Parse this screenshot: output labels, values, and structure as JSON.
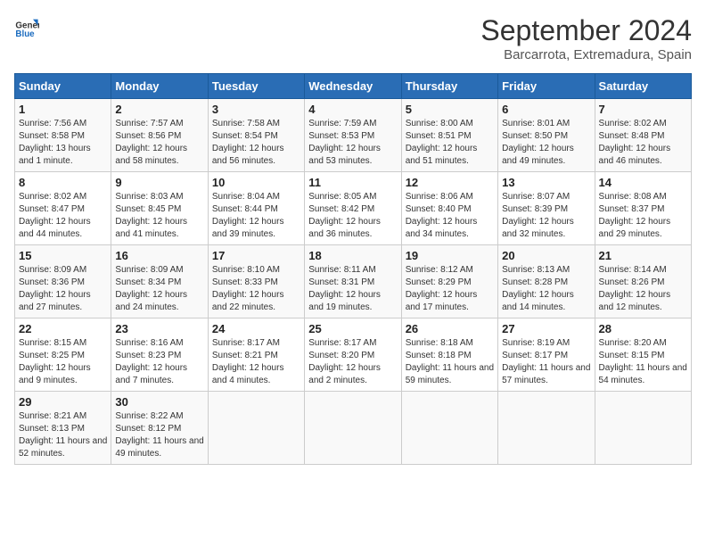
{
  "header": {
    "logo_line1": "General",
    "logo_line2": "Blue",
    "month": "September 2024",
    "location": "Barcarrota, Extremadura, Spain"
  },
  "weekdays": [
    "Sunday",
    "Monday",
    "Tuesday",
    "Wednesday",
    "Thursday",
    "Friday",
    "Saturday"
  ],
  "weeks": [
    [
      {
        "day": "1",
        "sunrise": "7:56 AM",
        "sunset": "8:58 PM",
        "daylight": "13 hours and 1 minute."
      },
      {
        "day": "2",
        "sunrise": "7:57 AM",
        "sunset": "8:56 PM",
        "daylight": "12 hours and 58 minutes."
      },
      {
        "day": "3",
        "sunrise": "7:58 AM",
        "sunset": "8:54 PM",
        "daylight": "12 hours and 56 minutes."
      },
      {
        "day": "4",
        "sunrise": "7:59 AM",
        "sunset": "8:53 PM",
        "daylight": "12 hours and 53 minutes."
      },
      {
        "day": "5",
        "sunrise": "8:00 AM",
        "sunset": "8:51 PM",
        "daylight": "12 hours and 51 minutes."
      },
      {
        "day": "6",
        "sunrise": "8:01 AM",
        "sunset": "8:50 PM",
        "daylight": "12 hours and 49 minutes."
      },
      {
        "day": "7",
        "sunrise": "8:02 AM",
        "sunset": "8:48 PM",
        "daylight": "12 hours and 46 minutes."
      }
    ],
    [
      {
        "day": "8",
        "sunrise": "8:02 AM",
        "sunset": "8:47 PM",
        "daylight": "12 hours and 44 minutes."
      },
      {
        "day": "9",
        "sunrise": "8:03 AM",
        "sunset": "8:45 PM",
        "daylight": "12 hours and 41 minutes."
      },
      {
        "day": "10",
        "sunrise": "8:04 AM",
        "sunset": "8:44 PM",
        "daylight": "12 hours and 39 minutes."
      },
      {
        "day": "11",
        "sunrise": "8:05 AM",
        "sunset": "8:42 PM",
        "daylight": "12 hours and 36 minutes."
      },
      {
        "day": "12",
        "sunrise": "8:06 AM",
        "sunset": "8:40 PM",
        "daylight": "12 hours and 34 minutes."
      },
      {
        "day": "13",
        "sunrise": "8:07 AM",
        "sunset": "8:39 PM",
        "daylight": "12 hours and 32 minutes."
      },
      {
        "day": "14",
        "sunrise": "8:08 AM",
        "sunset": "8:37 PM",
        "daylight": "12 hours and 29 minutes."
      }
    ],
    [
      {
        "day": "15",
        "sunrise": "8:09 AM",
        "sunset": "8:36 PM",
        "daylight": "12 hours and 27 minutes."
      },
      {
        "day": "16",
        "sunrise": "8:09 AM",
        "sunset": "8:34 PM",
        "daylight": "12 hours and 24 minutes."
      },
      {
        "day": "17",
        "sunrise": "8:10 AM",
        "sunset": "8:33 PM",
        "daylight": "12 hours and 22 minutes."
      },
      {
        "day": "18",
        "sunrise": "8:11 AM",
        "sunset": "8:31 PM",
        "daylight": "12 hours and 19 minutes."
      },
      {
        "day": "19",
        "sunrise": "8:12 AM",
        "sunset": "8:29 PM",
        "daylight": "12 hours and 17 minutes."
      },
      {
        "day": "20",
        "sunrise": "8:13 AM",
        "sunset": "8:28 PM",
        "daylight": "12 hours and 14 minutes."
      },
      {
        "day": "21",
        "sunrise": "8:14 AM",
        "sunset": "8:26 PM",
        "daylight": "12 hours and 12 minutes."
      }
    ],
    [
      {
        "day": "22",
        "sunrise": "8:15 AM",
        "sunset": "8:25 PM",
        "daylight": "12 hours and 9 minutes."
      },
      {
        "day": "23",
        "sunrise": "8:16 AM",
        "sunset": "8:23 PM",
        "daylight": "12 hours and 7 minutes."
      },
      {
        "day": "24",
        "sunrise": "8:17 AM",
        "sunset": "8:21 PM",
        "daylight": "12 hours and 4 minutes."
      },
      {
        "day": "25",
        "sunrise": "8:17 AM",
        "sunset": "8:20 PM",
        "daylight": "12 hours and 2 minutes."
      },
      {
        "day": "26",
        "sunrise": "8:18 AM",
        "sunset": "8:18 PM",
        "daylight": "11 hours and 59 minutes."
      },
      {
        "day": "27",
        "sunrise": "8:19 AM",
        "sunset": "8:17 PM",
        "daylight": "11 hours and 57 minutes."
      },
      {
        "day": "28",
        "sunrise": "8:20 AM",
        "sunset": "8:15 PM",
        "daylight": "11 hours and 54 minutes."
      }
    ],
    [
      {
        "day": "29",
        "sunrise": "8:21 AM",
        "sunset": "8:13 PM",
        "daylight": "11 hours and 52 minutes."
      },
      {
        "day": "30",
        "sunrise": "8:22 AM",
        "sunset": "8:12 PM",
        "daylight": "11 hours and 49 minutes."
      },
      null,
      null,
      null,
      null,
      null
    ]
  ]
}
